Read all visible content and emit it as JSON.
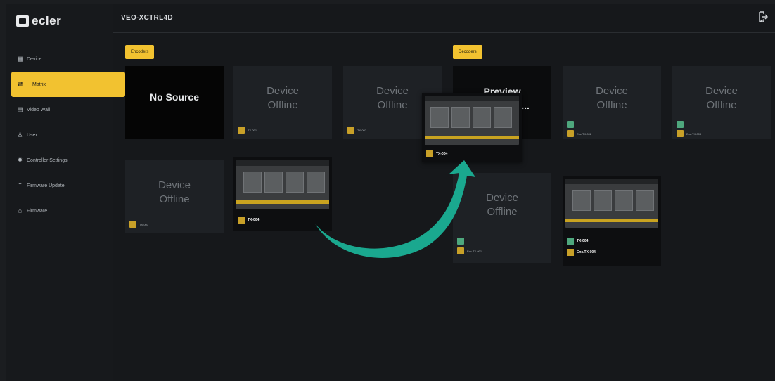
{
  "app": {
    "logo_text": "ecler",
    "title": "VEO-XCTRL4D"
  },
  "sidebar": {
    "items": [
      {
        "label": "Device",
        "icon": "grid-icon",
        "active": false
      },
      {
        "label": "Matrix",
        "icon": "arrows-icon",
        "active": true
      },
      {
        "label": "Video Wall",
        "icon": "videowall-icon",
        "active": false
      },
      {
        "label": "User",
        "icon": "user-icon",
        "active": false
      },
      {
        "label": "Controller Settings",
        "icon": "gear-icon",
        "active": false
      },
      {
        "label": "Firmware Update",
        "icon": "upload-icon",
        "active": false
      },
      {
        "label": "Firmware",
        "icon": "chip-icon",
        "active": false
      }
    ]
  },
  "sections": {
    "encoders_label": "Encoders",
    "decoders_label": "Decoders"
  },
  "encoders": [
    {
      "state": "No Source",
      "label": ""
    },
    {
      "state": "Device\nOffline",
      "label": "TX-001"
    },
    {
      "state": "Device\nOffline",
      "label": "TX-002"
    },
    {
      "state": "Device\nOffline",
      "label": "TX-003"
    },
    {
      "state": "preview",
      "label": "TX-004"
    }
  ],
  "decoders": [
    {
      "state": "Preview\nCapturing...",
      "label": "RX-001"
    },
    {
      "state": "Device\nOffline",
      "label": "RX-002",
      "source": "Enc.TX-002"
    },
    {
      "state": "Device\nOffline",
      "label": "RX-003",
      "source": "Enc.TX-003"
    },
    {
      "state": "Device\nOffline",
      "label": "RX-004",
      "source": "Enc.TX-001"
    },
    {
      "state": "preview",
      "label": "TX-004",
      "source": "Enc.TX-004"
    }
  ],
  "drag_preview": {
    "label": "TX-004"
  },
  "colors": {
    "accent": "#f2c230",
    "background": "#16181b",
    "tile": "#1e2125",
    "arrow": "#1aa88f"
  }
}
